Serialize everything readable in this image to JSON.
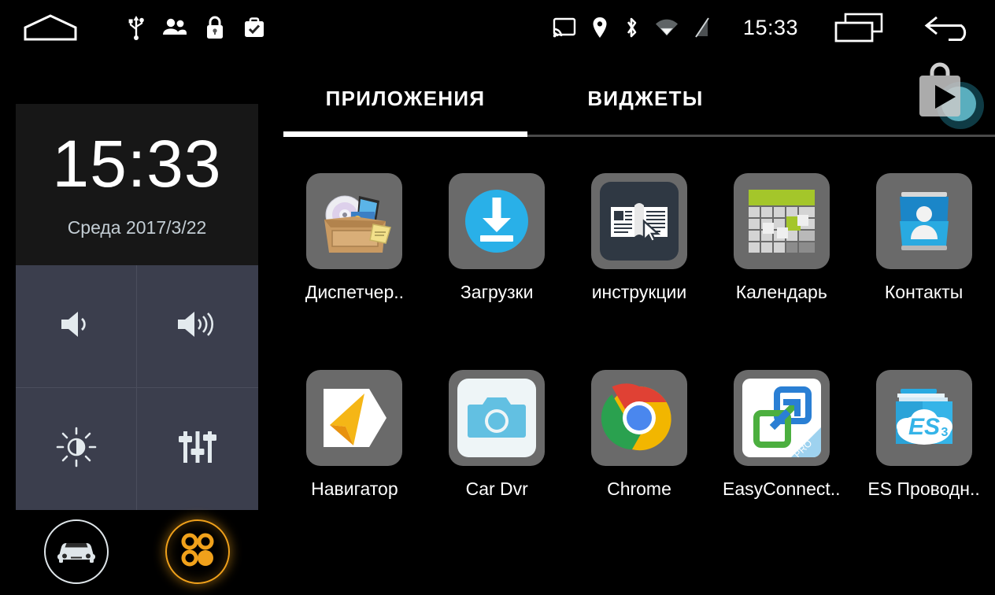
{
  "status_bar": {
    "left_icons": [
      "home-outline-icon",
      "usb-icon",
      "people-icon",
      "lock-icon",
      "briefcase-check-icon"
    ],
    "right_icons": [
      "cast-icon",
      "location-pin-icon",
      "bluetooth-icon",
      "wifi-icon",
      "signal-off-icon"
    ],
    "clock": "15:33",
    "nav_icons": [
      "recents-icon",
      "back-icon"
    ]
  },
  "left_panel": {
    "clock_widget": {
      "time": "15:33",
      "date": "Среда 2017/3/22"
    },
    "controls": [
      {
        "name": "volume-down-button",
        "icon": "volume-low-icon"
      },
      {
        "name": "volume-up-button",
        "icon": "volume-high-icon"
      },
      {
        "name": "brightness-button",
        "icon": "brightness-icon"
      },
      {
        "name": "equalizer-button",
        "icon": "equalizer-icon"
      }
    ],
    "dock": [
      {
        "name": "car-mode-button",
        "icon": "car-icon",
        "active": false,
        "color": "#dfe6ea"
      },
      {
        "name": "app-drawer-button",
        "icon": "apps-grid-icon",
        "active": true,
        "color": "#f0a11b"
      }
    ]
  },
  "app_drawer": {
    "tabs": [
      {
        "label": "ПРИЛОЖЕНИЯ",
        "active": true
      },
      {
        "label": "ВИДЖЕТЫ",
        "active": false
      }
    ],
    "playstore_icon": "play-store-bag-icon",
    "apps": [
      {
        "label": "Диспетчер..",
        "icon": "file-manager-box-icon"
      },
      {
        "label": "Загрузки",
        "icon": "downloads-icon"
      },
      {
        "label": "инструкции",
        "icon": "manual-book-icon"
      },
      {
        "label": "Календарь",
        "icon": "calendar-icon"
      },
      {
        "label": "Контакты",
        "icon": "contacts-icon"
      },
      {
        "label": "Навигатор",
        "icon": "navigator-arrow-icon"
      },
      {
        "label": "Car Dvr",
        "icon": "camera-icon"
      },
      {
        "label": "Chrome",
        "icon": "chrome-icon"
      },
      {
        "label": "EasyConnect..",
        "icon": "easyconnect-icon",
        "badge": "PRO"
      },
      {
        "label": "ES Проводн..",
        "icon": "es-file-explorer-icon"
      }
    ]
  },
  "colors": {
    "background": "#000000",
    "clock_widget_bg": "#171717",
    "control_grid_bg": "#3b3e4d",
    "tile_bg": "#6a6a6a",
    "accent_orange": "#f0a11b",
    "accent_blue": "#00a0e9",
    "tab_underline": "#ffffff"
  }
}
